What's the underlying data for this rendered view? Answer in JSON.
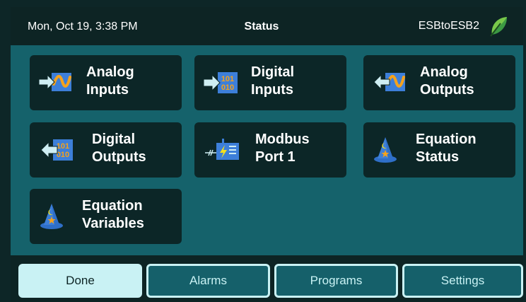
{
  "header": {
    "datetime": "Mon, Oct 19, 3:38 PM",
    "title": "Status",
    "device": "ESBtoESB2"
  },
  "tiles": [
    {
      "line1": "Analog",
      "line2": "Inputs",
      "icon": "analog-input-icon"
    },
    {
      "line1": "Digital",
      "line2": "Inputs",
      "icon": "digital-input-icon"
    },
    {
      "line1": "Analog",
      "line2": "Outputs",
      "icon": "analog-output-icon"
    },
    {
      "line1": "Digital",
      "line2": "Outputs",
      "icon": "digital-output-icon"
    },
    {
      "line1": "Modbus",
      "line2": "Port 1",
      "icon": "modbus-port-icon"
    },
    {
      "line1": "Equation",
      "line2": "Status",
      "icon": "wizard-hat-icon"
    },
    {
      "line1": "Equation",
      "line2": "Variables",
      "icon": "wizard-hat-icon"
    }
  ],
  "footer": {
    "done": "Done",
    "alarms": "Alarms",
    "programs": "Programs",
    "settings": "Settings"
  },
  "colors": {
    "background": "#15626b",
    "tile": "#0c2627",
    "bar": "#0d2424",
    "accent": "#c9f2f4",
    "icon_blue": "#3d7fd9",
    "icon_orange": "#f5a21c",
    "icon_arrow": "#cfeef3"
  }
}
